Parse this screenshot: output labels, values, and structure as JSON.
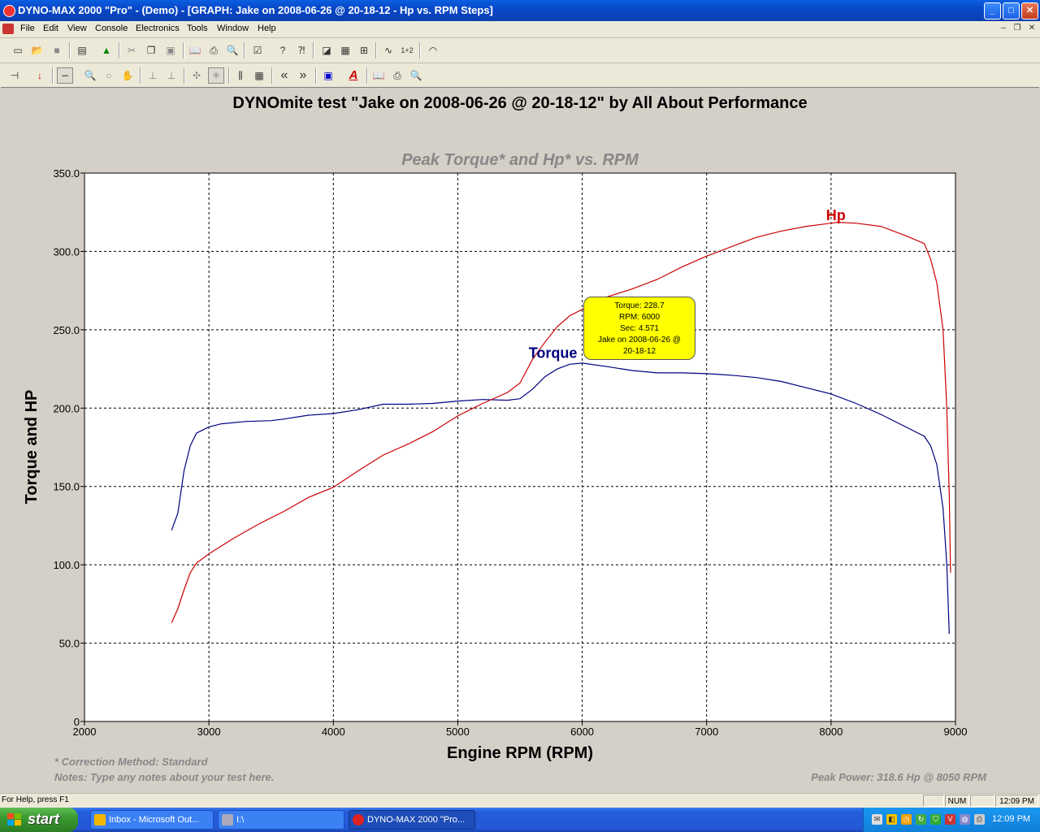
{
  "window": {
    "title": "DYNO-MAX 2000 \"Pro\" - (Demo) - [GRAPH: Jake on 2008-06-26 @ 20-18-12 - Hp vs. RPM Steps]",
    "min": "_",
    "max": "□",
    "close": "✕"
  },
  "menu": {
    "items": [
      "File",
      "Edit",
      "View",
      "Console",
      "Electronics",
      "Tools",
      "Window",
      "Help"
    ],
    "mdi_min": "–",
    "mdi_restore": "❐",
    "mdi_close": "✕"
  },
  "toolbar1": {
    "buttons": [
      "new-file",
      "open-folder",
      "save",
      "clipboard-open",
      "tree",
      "cut",
      "copy",
      "paste",
      "open-book",
      "print",
      "print-preview",
      "checklist",
      "help",
      "context-help",
      "run-test",
      "grid",
      "table",
      "waveform",
      "compare-1to2",
      "gauge"
    ],
    "compare_label": "1+2"
  },
  "toolbar2": {
    "buttons": [
      "pin",
      "red-arrow-down",
      "graph-zoom",
      "magnifier",
      "magnifier-out",
      "hand-pan",
      "step-1",
      "step-2",
      "cursor-cross",
      "cursor-star",
      "columns",
      "grid",
      "prev-page",
      "next-page",
      "window",
      "text-a",
      "book",
      "print",
      "print-preview"
    ],
    "prev_label": "«",
    "next_label": "»",
    "text_label": "A"
  },
  "graph": {
    "heading": "DYNOmite test \"Jake on 2008-06-26 @ 20-18-12\" by All About Performance",
    "subtitle": "Peak Torque* and Hp* vs. RPM",
    "correction_note": "* Correction Method: Standard",
    "notes": "Notes: Type any notes about your test here.",
    "peak_power": "Peak Power: 318.6 Hp @ 8050 RPM"
  },
  "tooltip": {
    "line1": "Torque:  228.7",
    "line2": "RPM:  6000",
    "line3": "Sec:  4.571",
    "line4": "Jake on 2008-06-26 @",
    "line5": "20-18-12"
  },
  "chart_data": {
    "type": "line",
    "title": "Peak Torque* and Hp* vs. RPM",
    "xlabel": "Engine RPM (RPM)",
    "ylabel": "Torque and HP",
    "xlim": [
      2000,
      9000
    ],
    "ylim": [
      0,
      350
    ],
    "x_ticks": [
      "2000",
      "3000",
      "4000",
      "5000",
      "6000",
      "7000",
      "8000",
      "9000"
    ],
    "y_ticks": [
      "0",
      "50.0",
      "100.0",
      "150.0",
      "200.0",
      "250.0",
      "300.0",
      "350.0"
    ],
    "grid": true,
    "series": [
      {
        "name": "Torque",
        "color": "#000080",
        "points": [
          [
            2700,
            122
          ],
          [
            2750,
            133
          ],
          [
            2800,
            160
          ],
          [
            2850,
            176
          ],
          [
            2900,
            184
          ],
          [
            3000,
            188
          ],
          [
            3100,
            190
          ],
          [
            3300,
            191.5
          ],
          [
            3500,
            192
          ],
          [
            3600,
            193
          ],
          [
            3800,
            195.5
          ],
          [
            4000,
            196.5
          ],
          [
            4200,
            199
          ],
          [
            4400,
            202.5
          ],
          [
            4600,
            202.5
          ],
          [
            4800,
            203
          ],
          [
            5000,
            204.5
          ],
          [
            5200,
            205.5
          ],
          [
            5400,
            205
          ],
          [
            5500,
            206
          ],
          [
            5600,
            212
          ],
          [
            5700,
            220
          ],
          [
            5800,
            225
          ],
          [
            5900,
            228
          ],
          [
            6000,
            228.7
          ],
          [
            6200,
            226.5
          ],
          [
            6400,
            224
          ],
          [
            6600,
            222.5
          ],
          [
            6800,
            222.5
          ],
          [
            7000,
            222
          ],
          [
            7200,
            221
          ],
          [
            7400,
            219.5
          ],
          [
            7600,
            217
          ],
          [
            7800,
            213
          ],
          [
            8000,
            209
          ],
          [
            8200,
            203
          ],
          [
            8400,
            196
          ],
          [
            8600,
            188
          ],
          [
            8750,
            182
          ],
          [
            8800,
            176
          ],
          [
            8850,
            164
          ],
          [
            8900,
            136
          ],
          [
            8930,
            100
          ],
          [
            8950,
            56
          ]
        ]
      },
      {
        "name": "Hp",
        "color": "#cc0000",
        "points": [
          [
            2700,
            63
          ],
          [
            2750,
            72
          ],
          [
            2800,
            84
          ],
          [
            2850,
            95
          ],
          [
            2900,
            101
          ],
          [
            3000,
            107
          ],
          [
            3200,
            117
          ],
          [
            3400,
            126
          ],
          [
            3600,
            134
          ],
          [
            3800,
            143
          ],
          [
            4000,
            149.5
          ],
          [
            4200,
            160
          ],
          [
            4400,
            170
          ],
          [
            4600,
            177
          ],
          [
            4800,
            185
          ],
          [
            5000,
            195
          ],
          [
            5200,
            203
          ],
          [
            5400,
            210
          ],
          [
            5500,
            216
          ],
          [
            5600,
            231
          ],
          [
            5700,
            242
          ],
          [
            5800,
            252
          ],
          [
            5900,
            259
          ],
          [
            6000,
            263
          ],
          [
            6200,
            271
          ],
          [
            6400,
            276
          ],
          [
            6600,
            282
          ],
          [
            6800,
            290
          ],
          [
            7000,
            297
          ],
          [
            7200,
            303
          ],
          [
            7400,
            309
          ],
          [
            7600,
            313
          ],
          [
            7800,
            316
          ],
          [
            8000,
            318
          ],
          [
            8050,
            318.6
          ],
          [
            8200,
            318
          ],
          [
            8400,
            316
          ],
          [
            8600,
            310
          ],
          [
            8750,
            305
          ],
          [
            8800,
            295
          ],
          [
            8850,
            280
          ],
          [
            8900,
            250
          ],
          [
            8930,
            200
          ],
          [
            8950,
            145
          ],
          [
            8960,
            95
          ]
        ]
      }
    ],
    "annotations": [
      {
        "text": "Hp",
        "x": 7960,
        "y": 320
      },
      {
        "text": "Torque",
        "x": 5570,
        "y": 232
      }
    ]
  },
  "status": {
    "help": "For Help, press F1",
    "num": "NUM",
    "time": "12:09 PM"
  },
  "taskbar": {
    "start": "start",
    "tasks": [
      "Inbox - Microsoft Out...",
      "I:\\",
      "DYNO-MAX 2000 \"Pro..."
    ],
    "clock": "12:09 PM"
  }
}
